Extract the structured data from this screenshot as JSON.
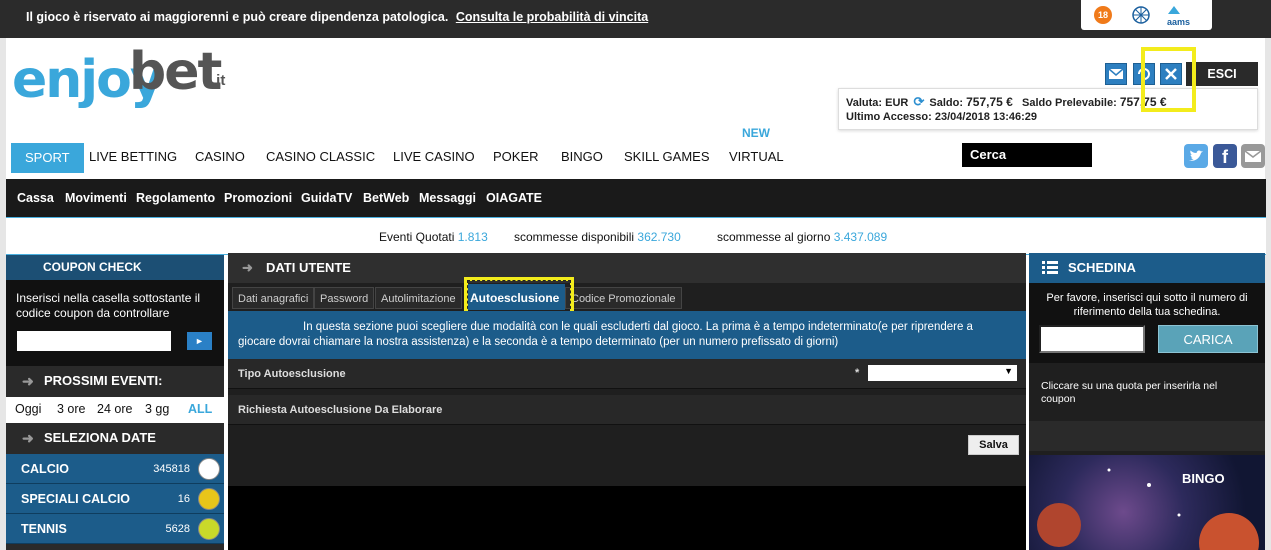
{
  "top_bar": {
    "warning": "Il gioco è riservato ai maggiorenni e può creare dipendenza patologica.",
    "link": "Consulta le probabilità di vincita",
    "badge_age": "18",
    "badge_aams": "aams"
  },
  "brand": {
    "name_part1": "enjoy",
    "name_part2": "bet",
    "tld": ".it"
  },
  "account": {
    "logout_label": "ESCI",
    "currency_label": "Valuta:",
    "currency": "EUR",
    "balance_label": "Saldo:",
    "balance": "757,75 €",
    "withdrawable_label": "Saldo Prelevabile:",
    "withdrawable": "757,75 €",
    "last_access_label": "Ultimo Accesso:",
    "last_access": "23/04/2018 13:46:29"
  },
  "main_nav": {
    "items": [
      "SPORT",
      "LIVE BETTING",
      "CASINO",
      "CASINO CLASSIC",
      "LIVE CASINO",
      "POKER",
      "BINGO",
      "SKILL GAMES",
      "VIRTUAL"
    ],
    "new_badge": "NEW",
    "search_placeholder": "Cerca"
  },
  "sub_nav": {
    "items": [
      "Cassa",
      "Movimenti",
      "Regolamento",
      "Promozioni",
      "GuidaTV",
      "BetWeb",
      "Messaggi",
      "OIAGATE"
    ]
  },
  "stats": {
    "events_label": "Eventi Quotati",
    "events_value": "1.813",
    "available_label": "scommesse disponibili",
    "available_value": "362.730",
    "daily_label": "scommesse al giorno",
    "daily_value": "3.437.089"
  },
  "left": {
    "coupon_title": "COUPON CHECK",
    "coupon_text": "Inserisci nella casella sottostante il codice coupon da controllare",
    "coupon_go": "►",
    "upcoming_title": "PROSSIMI EVENTI:",
    "time_filters": [
      "Oggi",
      "3 ore",
      "24 ore",
      "3 gg",
      "ALL"
    ],
    "dates_title": "SELEZIONA DATE",
    "sports": [
      {
        "name": "CALCIO",
        "count": "345818"
      },
      {
        "name": "SPECIALI CALCIO",
        "count": "16"
      },
      {
        "name": "TENNIS",
        "count": "5628"
      }
    ]
  },
  "center": {
    "title": "DATI UTENTE",
    "tabs": [
      "Dati anagrafici",
      "Password",
      "Autolimitazione",
      "Autoesclusione",
      "Codice Promozionale"
    ],
    "active_tab": "Autoesclusione",
    "info_line1": "In questa sezione puoi scegliere due modalità con le quali escluderti dal gioco. La prima è a tempo indeterminato(e per riprendere a",
    "info_line2": "giocare dovrai chiamare la nostra assistenza) e la seconda è a tempo determinato (per un numero prefissato di giorni)",
    "field_type_label": "Tipo Autoesclusione",
    "required_mark": "*",
    "select_value": "",
    "pending_label": "Richiesta Autoesclusione Da Elaborare",
    "save_label": "Salva"
  },
  "right": {
    "title": "SCHEDINA",
    "instructions": "Per favore, inserisci qui sotto il numero di riferimento della tua schedina.",
    "load_label": "CARICA",
    "hint": "Cliccare su una quota per inserirla nel coupon",
    "banner_label": "BINGO"
  },
  "colors": {
    "accent": "#3aa7db",
    "highlight": "#f3ec1c",
    "panel": "#1c5c8a"
  }
}
